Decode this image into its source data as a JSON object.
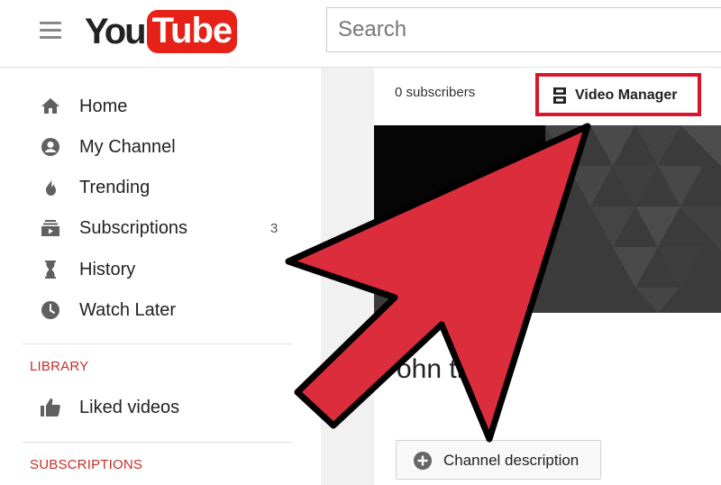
{
  "header": {
    "logo": {
      "you": "You",
      "tube": "Tube"
    },
    "search": {
      "placeholder": "Search",
      "value": ""
    }
  },
  "sidebar": {
    "items": [
      {
        "label": "Home",
        "icon": "home-icon"
      },
      {
        "label": "My Channel",
        "icon": "account-icon"
      },
      {
        "label": "Trending",
        "icon": "flame-icon"
      },
      {
        "label": "Subscriptions",
        "icon": "subscriptions-icon",
        "count": "3"
      },
      {
        "label": "History",
        "icon": "hourglass-icon"
      },
      {
        "label": "Watch Later",
        "icon": "clock-icon"
      }
    ],
    "library_heading": "LIBRARY",
    "library_items": [
      {
        "label": "Liked videos",
        "icon": "thumbs-up-icon"
      }
    ],
    "subscriptions_heading": "SUBSCRIPTIONS"
  },
  "channel": {
    "subscribers": "0 subscribers",
    "video_manager_label": "Video Manager",
    "name_visible": "ohn   th",
    "description_button": "Channel description"
  },
  "colors": {
    "youtube_red": "#e62117",
    "highlight_box": "#d6182a",
    "arrow_fill": "#dc2d3c",
    "section_heading": "#c4302b"
  }
}
